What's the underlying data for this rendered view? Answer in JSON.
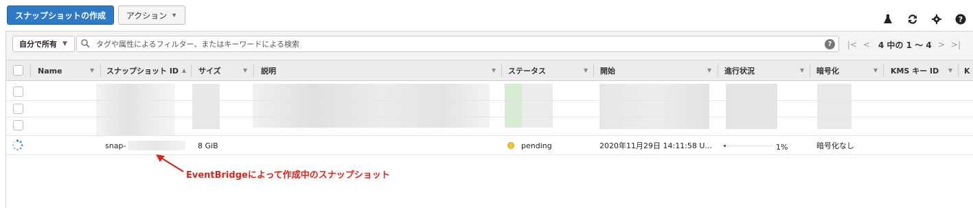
{
  "toolbar": {
    "create_label": "スナップショットの作成",
    "action_label": "アクション"
  },
  "filter": {
    "owner_label": "自分で所有",
    "search_placeholder": "タグや属性によるフィルター、またはキーワードによる検索",
    "pagination": "4 中の 1 〜 4"
  },
  "columns": [
    "Name",
    "スナップショット ID",
    "サイズ",
    "説明",
    "ステータス",
    "開始",
    "進行状況",
    "暗号化",
    "KMS キー ID",
    "K"
  ],
  "row": {
    "snapshot_id": "snap-",
    "size": "8 GiB",
    "status": "pending",
    "status_color": "#f1c232",
    "started": "2020年11月29日 14:11:58 U...",
    "progress": 0.01,
    "progress_label": "1%",
    "encryption": "暗号化なし"
  },
  "annotation": "EventBridgeによって作成中のスナップショット",
  "colors": {
    "primary": "#2f7ac6",
    "annotation": "#d9261c"
  }
}
